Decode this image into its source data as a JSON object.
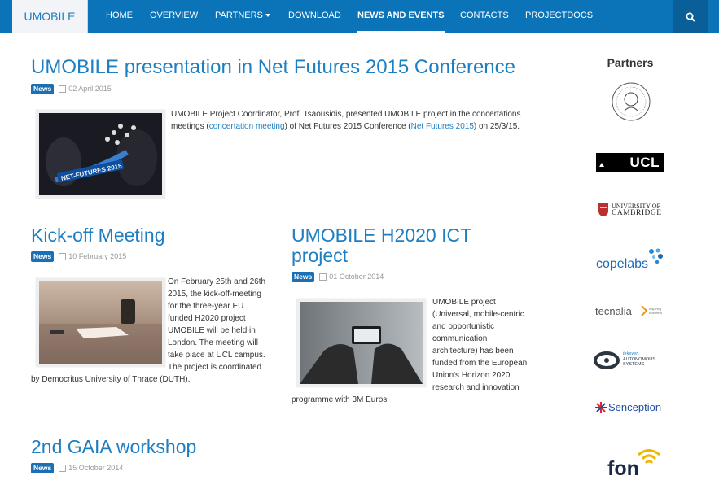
{
  "nav": {
    "brand": "UMOBILE",
    "items": [
      "HOME",
      "OVERVIEW",
      "PARTNERS",
      "DOWNLOAD",
      "NEWS AND EVENTS",
      "CONTACTS",
      "PROJECTDOCS"
    ],
    "active": "NEWS AND EVENTS"
  },
  "articles": [
    {
      "title": "UMOBILE presentation in Net Futures 2015 Conference",
      "badge": "News",
      "date": "02 April 2015",
      "text_a": "UMOBILE Project Coordinator, Prof. Tsaousidis, presented UMOBILE project in the concertations meetings (",
      "link1": "concertation meeting",
      "text_b": ") of Net Futures 2015 Conference (",
      "link2": "Net Futures 2015",
      "text_c": ") on 25/3/15.",
      "image_caption": "NET-FUTURES 2015"
    },
    {
      "title": "Kick-off Meeting",
      "badge": "News",
      "date": "10 February 2015",
      "text": "On February 25th and 26th 2015, the kick-off-meeting for the three-year EU funded H2020 project UMOBILE will be held in London. The meeting will take place at UCL campus. The project is coordinated by Democritus University of Thrace (DUTH)."
    },
    {
      "title": "UMOBILE H2020 ICT project",
      "badge": "News",
      "date": "01 October 2014",
      "text": "UMOBILE project (Universal, mobile-centric and opportunistic communication architecture) has been funded from the European Union's Horizon 2020 research and innovation programme with 3M Euros."
    },
    {
      "title": "2nd GAIA workshop",
      "badge": "News",
      "date": "15 October 2014"
    }
  ],
  "sidebar": {
    "title": "Partners",
    "logos": {
      "ucl": "UCL",
      "cambridge_1": "UNIVERSITY OF",
      "cambridge_2": "CAMBRIDGE",
      "copelabs": "copelabs",
      "tecnalia": "tecnalia",
      "tecnalia_tag": "Inspiring Business",
      "tekever_1": "tekever",
      "tekever_2": "AUTONOMOUS",
      "tekever_3": "SYSTEMS",
      "senception": "Senception",
      "fon": "fon"
    }
  },
  "colors": {
    "nav_bg": "#0b73b8",
    "link": "#1d7ec2",
    "badge": "#1d6fb3"
  }
}
